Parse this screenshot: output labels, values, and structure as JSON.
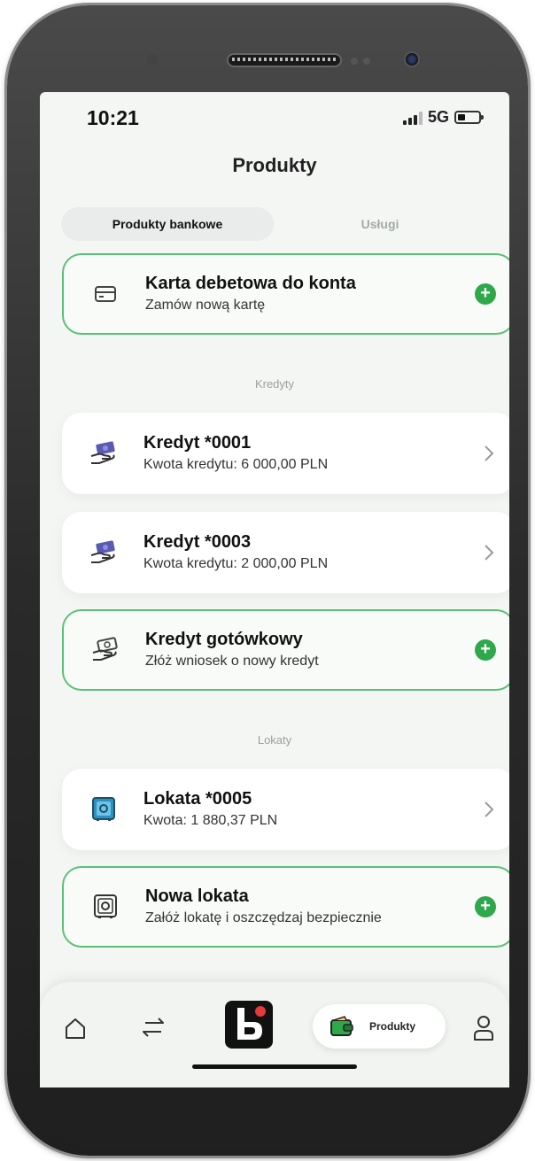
{
  "status_bar": {
    "time": "10:21",
    "network": "5G"
  },
  "header": {
    "title": "Produkty"
  },
  "tabs": [
    {
      "label": "Produkty bankowe",
      "active": true
    },
    {
      "label": "Usługi",
      "active": false
    }
  ],
  "new_card": {
    "title": "Karta debetowa do konta",
    "subtitle": "Zamów nową kartę"
  },
  "sections": {
    "credits": "Kredyty",
    "deposits": "Lokaty"
  },
  "credits": [
    {
      "title": "Kredyt *0001",
      "subtitle": "Kwota kredytu: 6 000,00 PLN"
    },
    {
      "title": "Kredyt *0003",
      "subtitle": "Kwota kredytu: 2 000,00 PLN"
    }
  ],
  "new_credit": {
    "title": "Kredyt gotówkowy",
    "subtitle": "Złóż wniosek o nowy kredyt"
  },
  "deposits": [
    {
      "title": "Lokata *0005",
      "subtitle": "Kwota: 1 880,37 PLN"
    }
  ],
  "new_deposit": {
    "title": "Nowa lokata",
    "subtitle": "Załóż lokatę i oszczędzaj bezpiecznie"
  },
  "tabbar": {
    "active_label": "Produkty"
  },
  "colors": {
    "accent_green": "#2ea84a",
    "outline_green": "#5cbf78",
    "background": "#f4f6f4"
  },
  "icons": [
    "home-icon",
    "transfer-icon",
    "brand-logo",
    "wallet-icon",
    "profile-icon",
    "card-icon",
    "cash-hand-icon",
    "safe-icon",
    "chevron-right-icon",
    "plus-icon"
  ]
}
